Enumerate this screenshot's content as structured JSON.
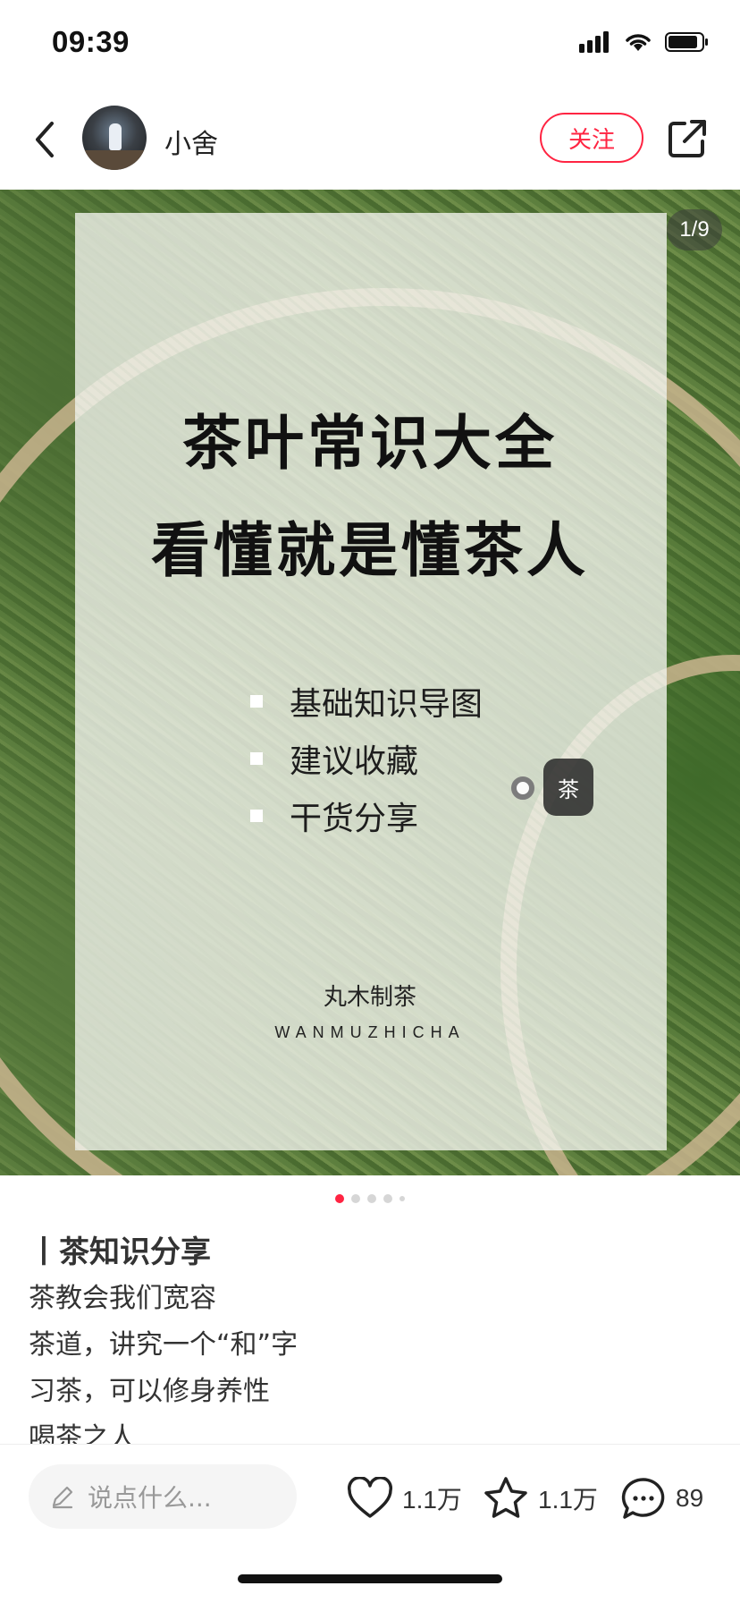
{
  "status_bar": {
    "time": "09:39",
    "icons": [
      "signal-icon",
      "wifi-icon",
      "battery-icon"
    ]
  },
  "header": {
    "username": "小舍",
    "follow_label": "关注",
    "icons": [
      "back-icon",
      "share-icon"
    ]
  },
  "image": {
    "counter": "1/9",
    "title_line1": "茶叶常识大全",
    "title_line2": "看懂就是懂茶人",
    "bullets": [
      "基础知识导图",
      "建议收藏",
      "干货分享"
    ],
    "tag": "茶",
    "brand_cn": "丸木制茶",
    "brand_en": "WANMUZHICHA"
  },
  "pager": {
    "total_visible_dots": 5,
    "active_index": 0
  },
  "post": {
    "title": "丨茶知识分享",
    "lines": [
      "茶教会我们宽容",
      "茶道，讲究一个“和”字",
      "习茶，可以修身养性",
      "喝茶之人"
    ]
  },
  "bottom_bar": {
    "comment_placeholder": "说点什么...",
    "likes": "1.1万",
    "favorites": "1.1万",
    "comments": "89",
    "icons": [
      "pencil-icon",
      "heart-icon",
      "star-icon",
      "comment-icon"
    ]
  },
  "colors": {
    "accent": "#ff2442",
    "text": "#333333"
  }
}
